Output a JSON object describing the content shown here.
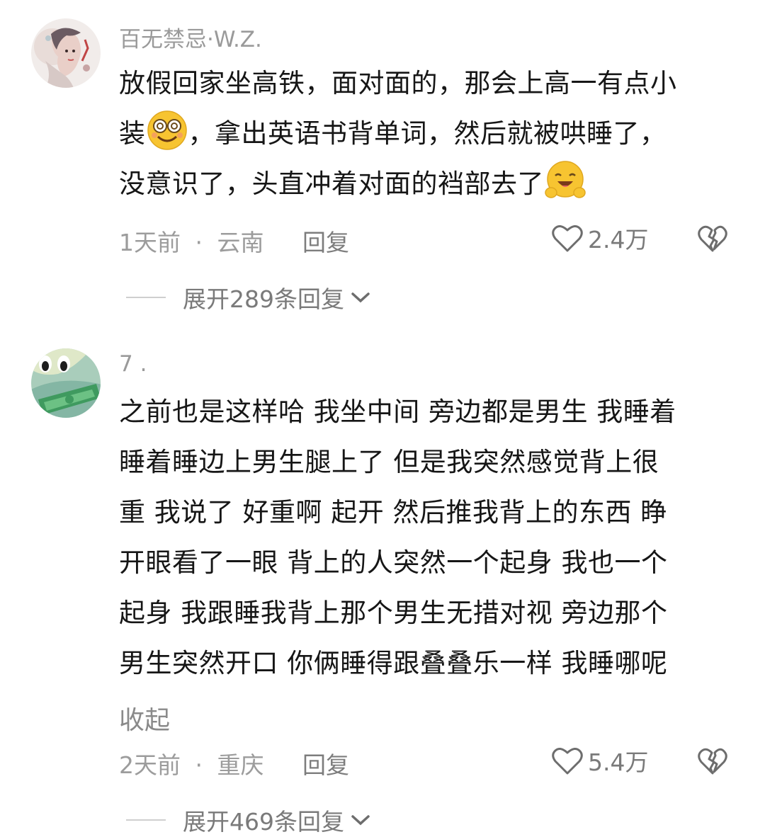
{
  "comments": [
    {
      "username": "百无禁忌·W.Z.",
      "lines": [
        "放假回家坐高铁，面对面的，那会上高一有点小",
        "，拿出英语书背单词，然后就被哄睡了，",
        "没意识了，头直冲着对面的裆部去了"
      ],
      "line2_prefix": "装",
      "emoji1": "dizzy-smile-emoji",
      "emoji2": "hug-emoji",
      "time": "1天前",
      "separator": "·",
      "location": "云南",
      "reply_label": "回复",
      "likes": "2.4万",
      "expand_label": "展开289条回复"
    },
    {
      "username": "7 .",
      "lines": [
        "之前也是这样哈 我坐中间 旁边都是男生 我睡着",
        "睡着睡边上男生腿上了 但是我突然感觉背上很",
        "重 我说了 好重啊 起开 然后推我背上的东西 睁",
        "开眼看了一眼 背上的人突然一个起身 我也一个",
        "起身 我跟睡我背上那个男生无措对视 旁边那个",
        "男生突然开口 你俩睡得跟叠叠乐一样 我睡哪呢"
      ],
      "collapse_label": "收起",
      "time": "2天前",
      "separator": "·",
      "location": "重庆",
      "reply_label": "回复",
      "likes": "5.4万",
      "expand_label": "展开469条回复"
    }
  ],
  "icons": {
    "like": "heart-outline-icon",
    "dislike": "broken-heart-icon",
    "expand": "chevron-down-icon"
  }
}
